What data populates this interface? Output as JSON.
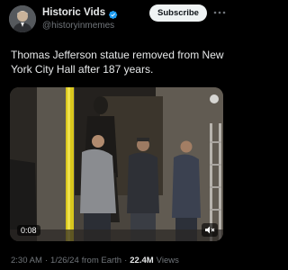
{
  "author": {
    "display_name": "Historic Vids",
    "handle": "@historyinmemes",
    "verified": true,
    "verified_color": "#1d9bf0"
  },
  "actions": {
    "subscribe_label": "Subscribe",
    "more_icon": "ellipsis-icon"
  },
  "tweet": {
    "text": "Thomas Jefferson statue removed from New York City Hall after 187 years."
  },
  "media": {
    "type": "video",
    "duration": "0:08",
    "mute_icon": "speaker-muted-icon"
  },
  "meta": {
    "time": "2:30 AM",
    "dot1": "·",
    "date": "1/26/24",
    "source": "from Earth",
    "dot2": "·",
    "views_count": "22.4M",
    "views_label": "Views"
  },
  "colors": {
    "background": "#000000",
    "text_primary": "#e7e9ea",
    "text_secondary": "#71767b",
    "subscribe_bg": "#eff3f4"
  }
}
